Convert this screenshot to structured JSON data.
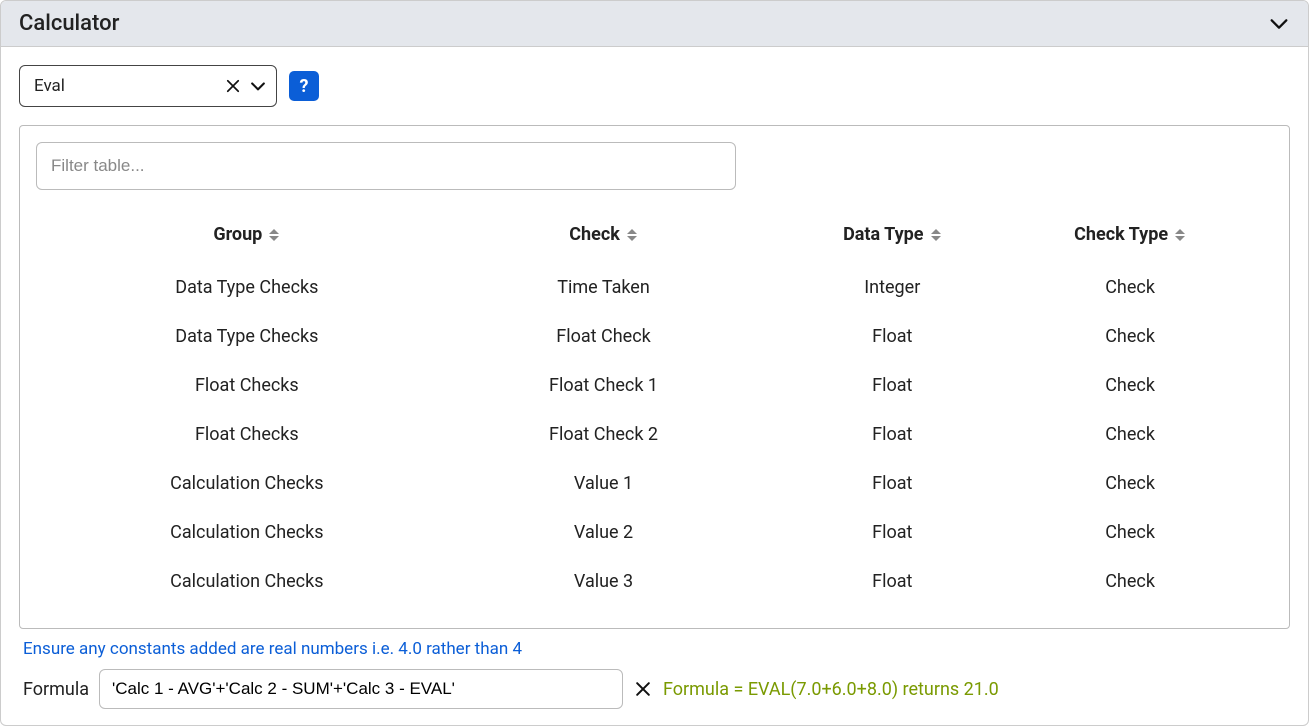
{
  "panel": {
    "title": "Calculator"
  },
  "combo": {
    "value": "Eval"
  },
  "filter": {
    "placeholder": "Filter table..."
  },
  "columns": {
    "group": "Group",
    "check": "Check",
    "dataType": "Data Type",
    "checkType": "Check Type"
  },
  "rows": [
    {
      "group": "Data Type Checks",
      "check": "Time Taken",
      "dataType": "Integer",
      "checkType": "Check"
    },
    {
      "group": "Data Type Checks",
      "check": "Float Check",
      "dataType": "Float",
      "checkType": "Check"
    },
    {
      "group": "Float Checks",
      "check": "Float Check 1",
      "dataType": "Float",
      "checkType": "Check"
    },
    {
      "group": "Float Checks",
      "check": "Float Check 2",
      "dataType": "Float",
      "checkType": "Check"
    },
    {
      "group": "Calculation Checks",
      "check": "Value 1",
      "dataType": "Float",
      "checkType": "Check"
    },
    {
      "group": "Calculation Checks",
      "check": "Value 2",
      "dataType": "Float",
      "checkType": "Check"
    },
    {
      "group": "Calculation Checks",
      "check": "Value 3",
      "dataType": "Float",
      "checkType": "Check"
    }
  ],
  "hint": "Ensure any constants added are real numbers i.e. 4.0 rather than 4",
  "formula": {
    "label": "Formula",
    "value": "'Calc 1 - AVG'+'Calc 2 - SUM'+'Calc 3 - EVAL'",
    "result": "Formula = EVAL(7.0+6.0+8.0) returns 21.0"
  },
  "help": {
    "label": "?"
  }
}
